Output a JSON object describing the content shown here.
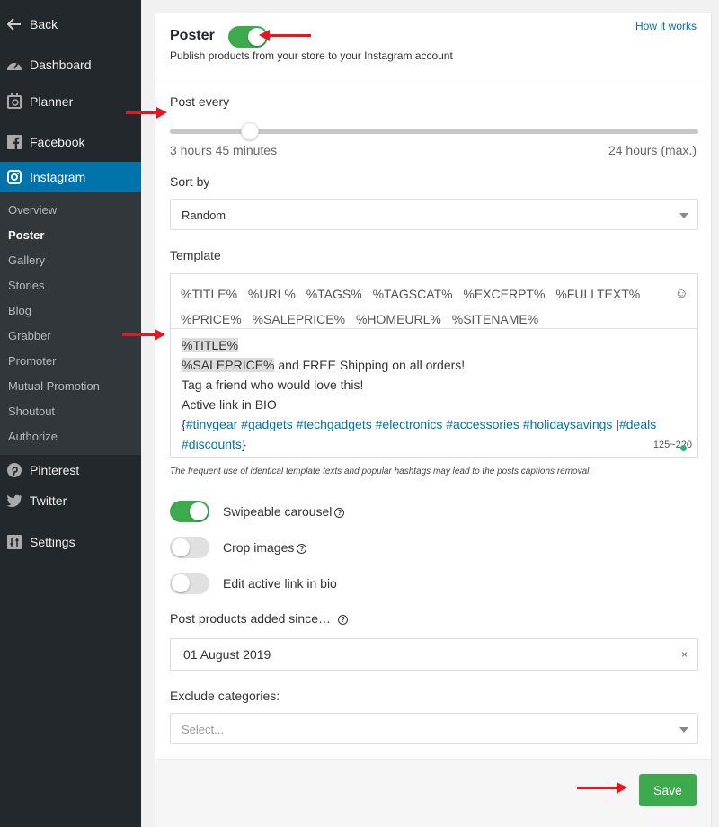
{
  "sidebar": {
    "back": "Back",
    "dashboard": "Dashboard",
    "planner": "Planner",
    "facebook": "Facebook",
    "instagram": "Instagram",
    "submenu": [
      "Overview",
      "Poster",
      "Gallery",
      "Stories",
      "Blog",
      "Grabber",
      "Promoter",
      "Mutual Promotion",
      "Shoutout",
      "Authorize"
    ],
    "pinterest": "Pinterest",
    "twitter": "Twitter",
    "settings": "Settings"
  },
  "poster": {
    "title": "Poster",
    "enabled": true,
    "subtitle": "Publish products from your store to your Instagram account",
    "how_it_works": "How it works"
  },
  "post_every": {
    "label": "Post every",
    "value": "3 hours 45 minutes",
    "max": "24 hours (max.)",
    "fraction": 0.156
  },
  "sort_by": {
    "label": "Sort by",
    "value": "Random"
  },
  "template": {
    "label": "Template",
    "variables": [
      "%TITLE%",
      "%URL%",
      "%TAGS%",
      "%TAGSCAT%",
      "%EXCERPT%",
      "%FULLTEXT%",
      "%PRICE%",
      "%SALEPRICE%",
      "%HOMEURL%",
      "%SITENAME%"
    ],
    "line1": "%TITLE%",
    "line2_var": "%SALEPRICE%",
    "line2_text": " and FREE Shipping on all orders!",
    "line3": "Tag a friend who would love this!",
    "line4": "Active link in BIO",
    "tags_open": "{",
    "tags1": "#tinygear #gadgets #techgadgets #electronics #accessories #holidaysavings ",
    "tags_pipe": "|",
    "tags2": "#deals",
    "tags3": "#discounts",
    "tags_close": "}",
    "counter": "125~220",
    "note": "The frequent use of identical template texts and popular hashtags may lead to the posts captions removal."
  },
  "options": {
    "swipeable": "Swipeable carousel",
    "crop": "Crop images",
    "edit_link": "Edit active link in bio"
  },
  "post_since": {
    "label": "Post products added since…",
    "value": "01 August 2019",
    "clear": "×"
  },
  "exclude": {
    "label": "Exclude categories:",
    "placeholder": "Select..."
  },
  "save_label": "Save",
  "colors": {
    "sidebar_bg": "#23282d",
    "active_blue": "#0073aa",
    "green": "#3daa4d",
    "arrow_red": "#e8141e"
  }
}
